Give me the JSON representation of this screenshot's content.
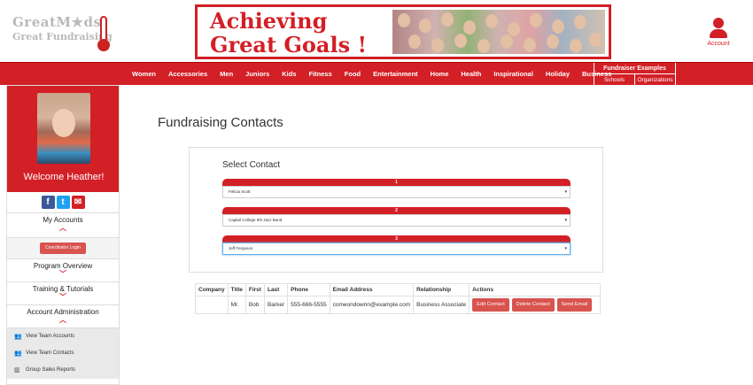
{
  "brand": {
    "logo_line1": "GreatM★ds",
    "logo_line2": "Great Fundraising"
  },
  "banner": {
    "line1": "Achieving",
    "line2": "Great Goals !"
  },
  "account": {
    "label": "Account"
  },
  "nav": {
    "items": [
      "Women",
      "Accessories",
      "Men",
      "Juniors",
      "Kids",
      "Fitness",
      "Food",
      "Entertainment",
      "Home",
      "Health",
      "Inspirational",
      "Holiday",
      "Business"
    ],
    "fundraiser": {
      "title": "Fundraiser Examples",
      "schools": "Schools",
      "organizations": "Organizations"
    }
  },
  "sidebar": {
    "welcome": "Welcome Heather!",
    "my_accounts": "My Accounts",
    "coordinator_login": "Coordinator Login",
    "program_overview": "Program Overview",
    "training": "Training & Tutorials",
    "account_admin": "Account Administration",
    "sub_items": [
      "View Team Accounts",
      "View Team Contacts",
      "Group Sales Reports"
    ]
  },
  "main": {
    "page_title": "Fundraising Contacts",
    "select_title": "Select Contact",
    "selects": [
      {
        "num": "1",
        "value": "Felicia Scott"
      },
      {
        "num": "2",
        "value": "Capital College 9/5 Jazz Band"
      },
      {
        "num": "3",
        "value": "Jeff Ferguson"
      }
    ]
  },
  "table": {
    "headers": [
      "Company",
      "Title",
      "First",
      "Last",
      "Phone",
      "Email Address",
      "Relationship",
      "Actions"
    ],
    "row": {
      "company": "",
      "title": "Mr.",
      "first": "Bob",
      "last": "Barker",
      "phone": "555-666-5555",
      "email": "comeondownn@example.com",
      "relationship": "Business Associate"
    },
    "actions": {
      "edit": "Edit Contact",
      "delete": "Delete Contact",
      "send": "Send Email"
    }
  },
  "colors": {
    "brand_red": "#d31f26",
    "button_red": "#d9534f"
  }
}
